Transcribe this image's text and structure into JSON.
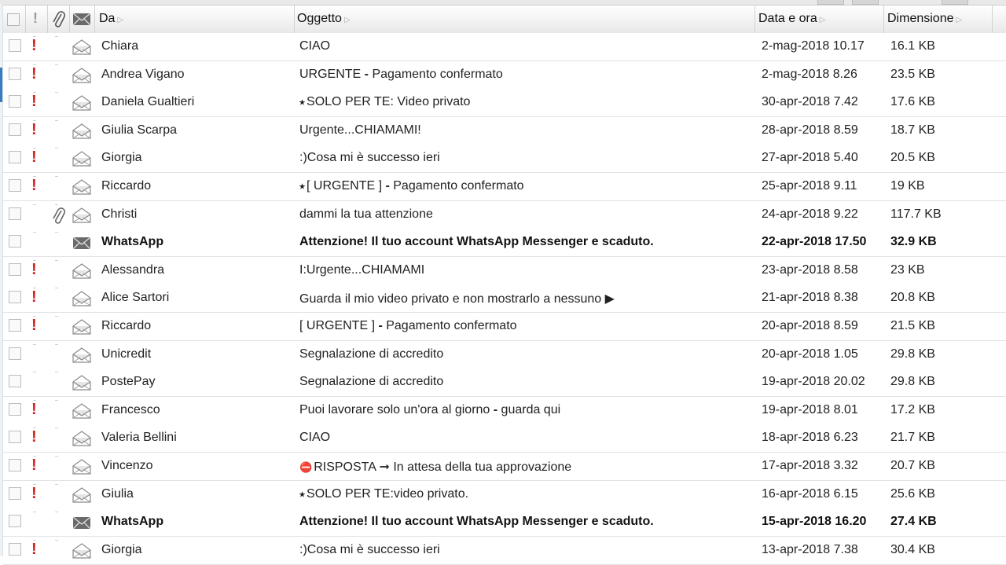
{
  "columns": {
    "from": "Da",
    "subject": "Oggetto",
    "date": "Data e ora",
    "size": "Dimensione"
  },
  "header_icons": [
    "checkbox-icon",
    "priority-icon",
    "attachment-icon",
    "envelope-icon"
  ],
  "colors": {
    "priority": "#d8201b",
    "header_bg": "#e8e8e8",
    "row_border": "#e2e2e2"
  },
  "emails": [
    {
      "from": "Chiara",
      "subject": "CIAO",
      "date": "2-mag-2018 10.17",
      "size": "16.1 KB",
      "priority": true,
      "read": true
    },
    {
      "from": "Andrea Vigano",
      "subject_html": "URGENTE <b>-</b> Pagamento confermato",
      "date": "2-mag-2018 8.26",
      "size": "23.5 KB",
      "priority": true,
      "read": true
    },
    {
      "from": "Daniela Gualtieri",
      "prefix": "⭑",
      "subject": "SOLO PER TE: Video privato",
      "date": "30-apr-2018 7.42",
      "size": "17.6 KB",
      "priority": true,
      "read": true
    },
    {
      "from": "Giulia Scarpa",
      "subject": "Urgente...CHIAMAMI!",
      "date": "28-apr-2018 8.59",
      "size": "18.7 KB",
      "priority": true,
      "read": true
    },
    {
      "from": "Giorgia",
      "subject": ":)Cosa mi è successo ieri",
      "date": "27-apr-2018 5.40",
      "size": "20.5 KB",
      "priority": true,
      "read": true
    },
    {
      "from": "Riccardo",
      "prefix": "⭑",
      "subject_html": "[ URGENTE ] <b>-</b> Pagamento confermato",
      "date": "25-apr-2018 9.11",
      "size": "19 KB",
      "priority": true,
      "read": true
    },
    {
      "from": "Christi",
      "subject": "dammi la tua attenzione",
      "date": "24-apr-2018 9.22",
      "size": "117.7 KB",
      "priority": false,
      "attachment": true,
      "read": true
    },
    {
      "from": "WhatsApp",
      "subject": "Attenzione! Il tuo account WhatsApp Messenger e scaduto.",
      "date": "22-apr-2018 17.50",
      "size": "32.9 KB",
      "priority": false,
      "read": false
    },
    {
      "from": "Alessandra",
      "subject": "I:Urgente...CHIAMAMI",
      "date": "23-apr-2018 8.58",
      "size": "23 KB",
      "priority": true,
      "read": true
    },
    {
      "from": "Alice Sartori",
      "subject": "Guarda il mio video privato e non mostrarlo a nessuno ▶",
      "date": "21-apr-2018 8.38",
      "size": "20.8 KB",
      "priority": true,
      "read": true
    },
    {
      "from": "Riccardo",
      "subject_html": "[ URGENTE ] <b>-</b> Pagamento confermato",
      "date": "20-apr-2018 8.59",
      "size": "21.5 KB",
      "priority": true,
      "read": true
    },
    {
      "from": "Unicredit",
      "subject": "Segnalazione di accredito",
      "date": "20-apr-2018 1.05",
      "size": "29.8 KB",
      "priority": false,
      "read": true
    },
    {
      "from": "PostePay",
      "subject": "Segnalazione di accredito",
      "date": "19-apr-2018 20.02",
      "size": "29.8 KB",
      "priority": false,
      "read": true
    },
    {
      "from": "Francesco",
      "subject_html": "Puoi lavorare solo un'ora al giorno <b>-</b> guarda qui",
      "date": "19-apr-2018 8.01",
      "size": "17.2 KB",
      "priority": true,
      "read": true
    },
    {
      "from": "Valeria Bellini",
      "subject": "CIAO",
      "date": "18-apr-2018 6.23",
      "size": "21.7 KB",
      "priority": true,
      "read": true
    },
    {
      "from": "Vincenzo",
      "prefix": "⛔",
      "subject": "RISPOSTA ➞ In attesa della tua approvazione",
      "date": "17-apr-2018 3.32",
      "size": "20.7 KB",
      "priority": true,
      "read": true
    },
    {
      "from": "Giulia",
      "prefix": "⭑",
      "subject": "SOLO PER TE:video privato.",
      "date": "16-apr-2018 6.15",
      "size": "25.6 KB",
      "priority": true,
      "read": true
    },
    {
      "from": "WhatsApp",
      "subject": "Attenzione! Il tuo account WhatsApp Messenger e scaduto.",
      "date": "15-apr-2018 16.20",
      "size": "27.4 KB",
      "priority": false,
      "read": false
    },
    {
      "from": "Giorgia",
      "subject": ":)Cosa mi è successo ieri",
      "date": "13-apr-2018 7.38",
      "size": "30.4 KB",
      "priority": true,
      "read": true
    }
  ]
}
